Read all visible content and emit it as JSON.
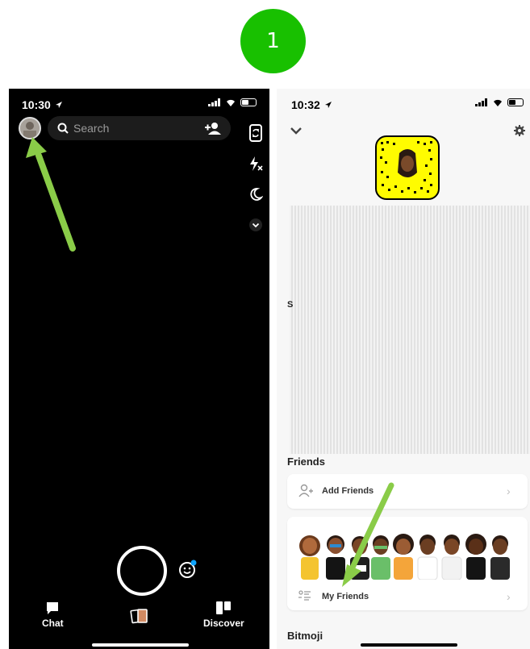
{
  "step": {
    "number": "1"
  },
  "left_screen": {
    "status_bar": {
      "time": "10:30"
    },
    "search": {
      "label": "Search"
    },
    "nav": {
      "chat_label": "Chat",
      "discover_label": "Discover"
    },
    "icons": [
      "avatar",
      "search-icon",
      "add-friend-icon",
      "flip-camera-icon",
      "flash-off-icon",
      "night-mode-icon",
      "chevron-down-icon",
      "lens-icon",
      "chat-icon",
      "memories-icon",
      "discover-icon"
    ]
  },
  "right_screen": {
    "status_bar": {
      "time": "10:32"
    },
    "friends": {
      "section_title": "Friends",
      "add_friends_label": "Add Friends",
      "my_friends_label": "My Friends"
    },
    "partial_letter": "S",
    "bitmoji": {
      "section_title": "Bitmoji"
    }
  },
  "colors": {
    "badge": "#18c000",
    "arrow": "#8acc48",
    "snap_yellow": "#fffc00"
  }
}
